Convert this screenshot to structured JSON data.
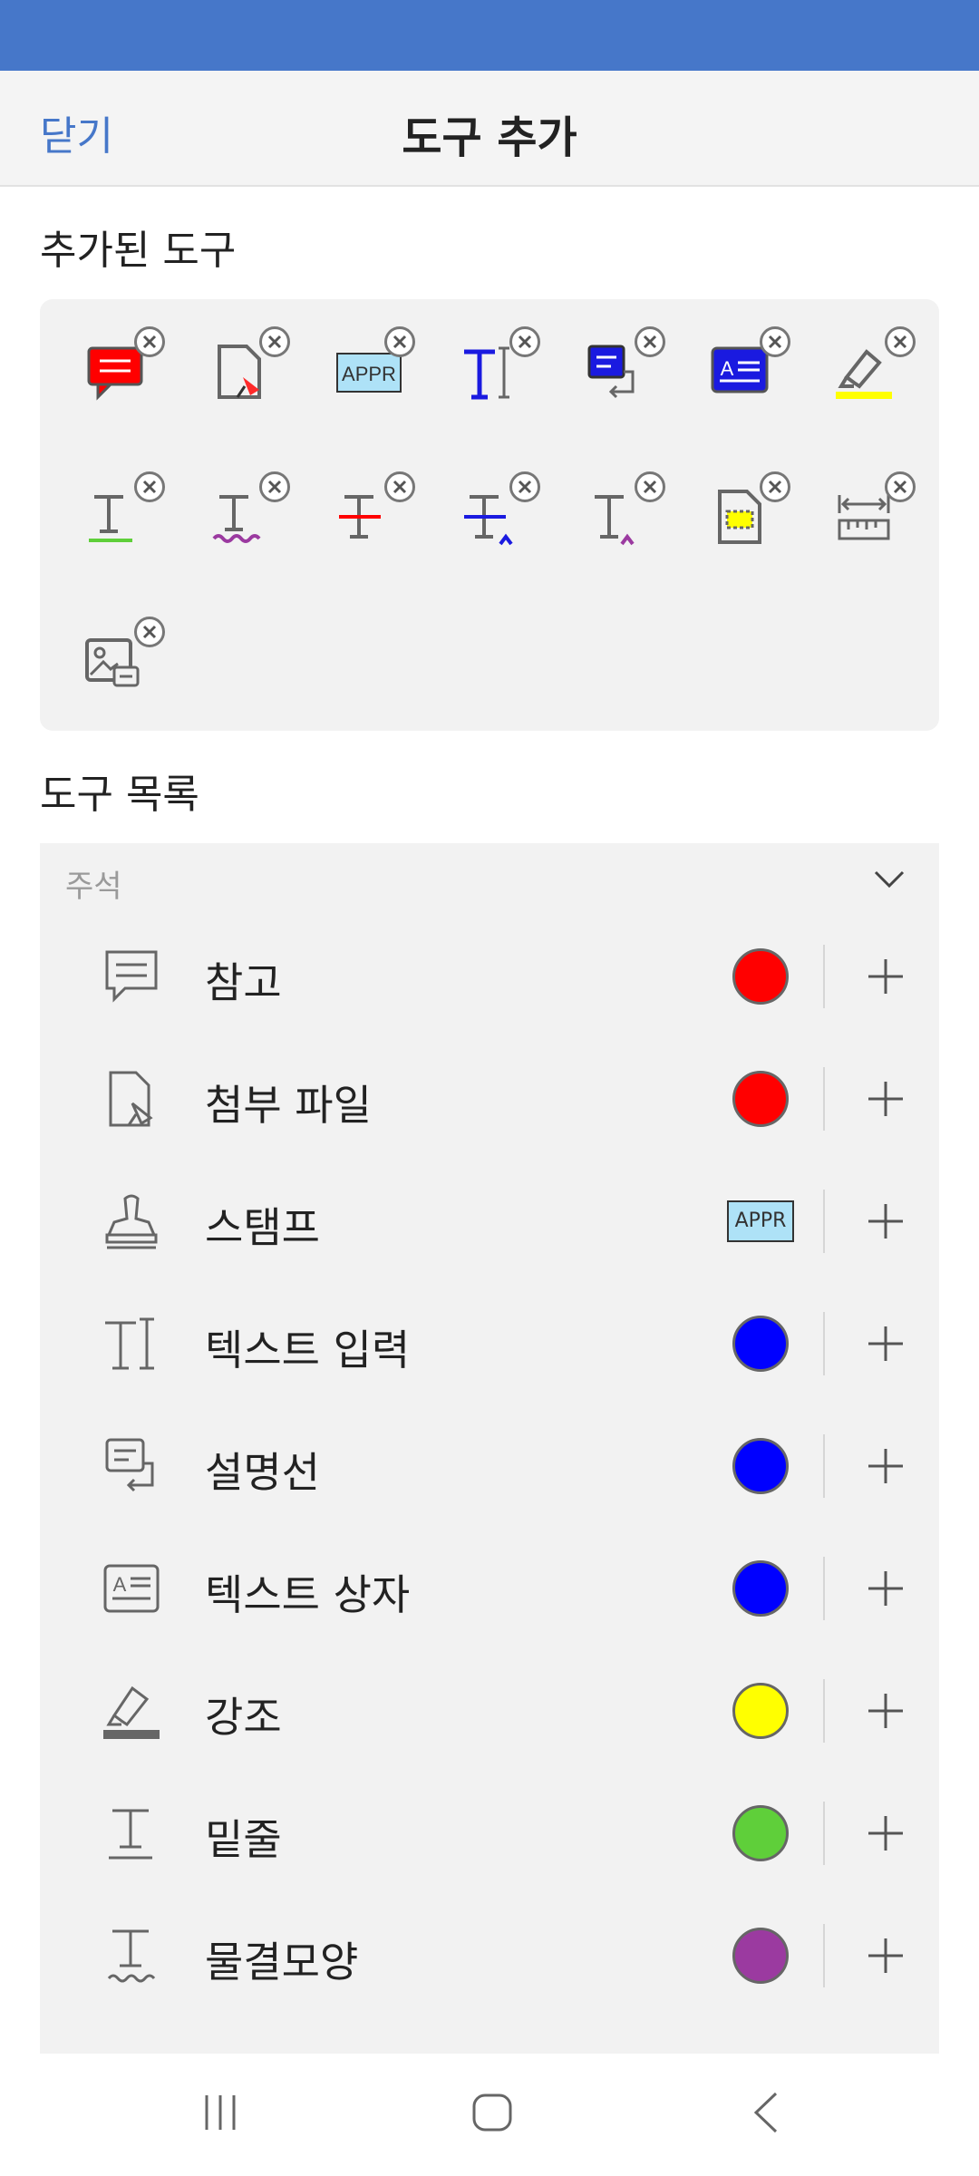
{
  "header": {
    "close_label": "닫기",
    "title": "도구 추가"
  },
  "added": {
    "title": "추가된 도구",
    "tools": [
      {
        "icon": "note-icon",
        "color": "#ff0000"
      },
      {
        "icon": "attach-file-icon",
        "color": "#ff0000"
      },
      {
        "icon": "stamp-appr-icon",
        "color": "#aee2f7",
        "text": "APPR"
      },
      {
        "icon": "text-input-icon",
        "color": "#0000ff"
      },
      {
        "icon": "callout-icon",
        "color": "#0000ff"
      },
      {
        "icon": "text-box-icon",
        "color": "#0000ff"
      },
      {
        "icon": "highlight-icon",
        "color": "#ffff00"
      },
      {
        "icon": "underline-icon",
        "color": "#5fcf3a"
      },
      {
        "icon": "squiggly-icon",
        "color": "#9b3aa0"
      },
      {
        "icon": "strikeout-icon",
        "color": "#ff0000"
      },
      {
        "icon": "replace-text-icon",
        "color": "#0000ff"
      },
      {
        "icon": "insert-text-icon",
        "color": "#9b3aa0"
      },
      {
        "icon": "file-area-icon",
        "color": "#ffff00"
      },
      {
        "icon": "measure-icon",
        "color": "#666666"
      },
      {
        "icon": "image-note-icon",
        "color": "#666666"
      }
    ]
  },
  "list": {
    "title": "도구 목록",
    "group_label": "주석",
    "rows": [
      {
        "label": "참고",
        "icon": "note-icon",
        "color": "#ff0000"
      },
      {
        "label": "첨부 파일",
        "icon": "attach-file-icon",
        "color": "#ff0000"
      },
      {
        "label": "스탬프",
        "icon": "stamp-icon",
        "stamp_text": "APPR"
      },
      {
        "label": "텍스트 입력",
        "icon": "text-input-icon",
        "color": "#0000ff"
      },
      {
        "label": "설명선",
        "icon": "callout-icon",
        "color": "#0000ff"
      },
      {
        "label": "텍스트 상자",
        "icon": "text-box-icon",
        "color": "#0000ff"
      },
      {
        "label": "강조",
        "icon": "highlight-icon",
        "color": "#ffff00"
      },
      {
        "label": "밑줄",
        "icon": "underline-icon",
        "color": "#5fcf3a"
      },
      {
        "label": "물결모양",
        "icon": "squiggly-icon",
        "color": "#9b3aa0"
      }
    ]
  },
  "colors": {
    "accent": "#4677c9"
  }
}
